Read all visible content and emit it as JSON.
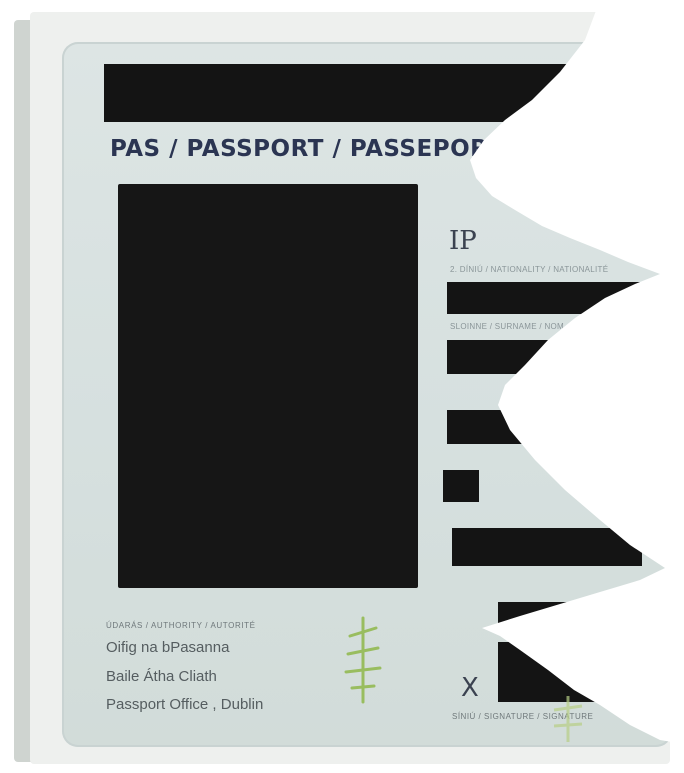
{
  "card": {
    "title": "PAS / PASSPORT / PASSEPORT",
    "type_code": "IP",
    "field_label_nationality": "2. DÍNIÚ / NATIONALITY / NATIONALITÉ",
    "field_label_surname": "SLOINNE / SURNAME / NOM",
    "issuing_authority": {
      "label": "ÚDARÁS / AUTHORITY / AUTORITÉ",
      "lines": [
        "Oifig na bPasanna",
        "Baile Átha Cliath",
        "Passport Office , Dublin"
      ]
    },
    "signature_mark": "X",
    "signature_label": "SÍNIÚ / SIGNATURE / SIGNATURE",
    "colors": {
      "card_bg": "#d8e2e1",
      "title_text": "#2b3552",
      "redaction": "#141414",
      "emblem_green": "#8fb84a"
    }
  }
}
